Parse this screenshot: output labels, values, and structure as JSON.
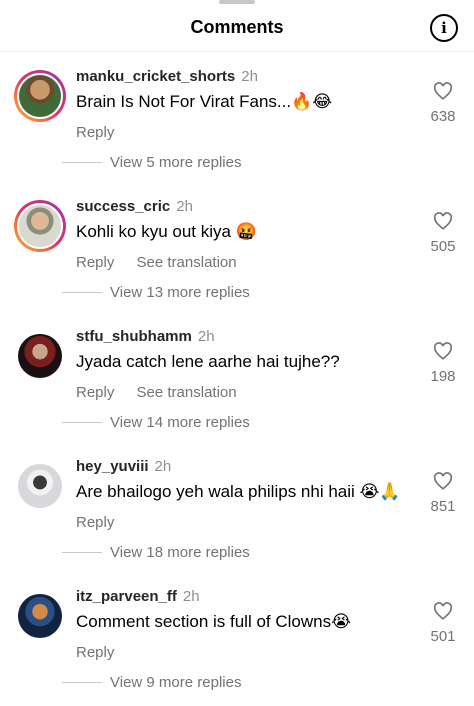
{
  "header": {
    "title": "Comments",
    "info_glyph": "i"
  },
  "actions": {
    "reply": "Reply",
    "translate": "See translation"
  },
  "comments": [
    {
      "username": "manku_cricket_shorts",
      "time": "2h",
      "text": "Brain Is Not For Virat Fans...🔥😂",
      "likes": "638",
      "replies": "View 5 more replies",
      "has_translation": false
    },
    {
      "username": "success_cric",
      "time": "2h",
      "text": "Kohli ko kyu out kiya 🤬",
      "likes": "505",
      "replies": "View 13 more replies",
      "has_translation": true
    },
    {
      "username": "stfu_shubhamm",
      "time": "2h",
      "text": "Jyada catch lene aarhe hai tujhe??",
      "likes": "198",
      "replies": "View 14 more replies",
      "has_translation": true
    },
    {
      "username": "hey_yuviii",
      "time": "2h",
      "text": "Are bhailogo yeh wala philips nhi haii 😭🙏",
      "likes": "851",
      "replies": "View 18 more replies",
      "has_translation": false
    },
    {
      "username": "itz_parveen_ff",
      "time": "2h",
      "text": "Comment section is full of Clowns😭",
      "likes": "501",
      "replies": "View 9 more replies",
      "has_translation": false
    }
  ]
}
